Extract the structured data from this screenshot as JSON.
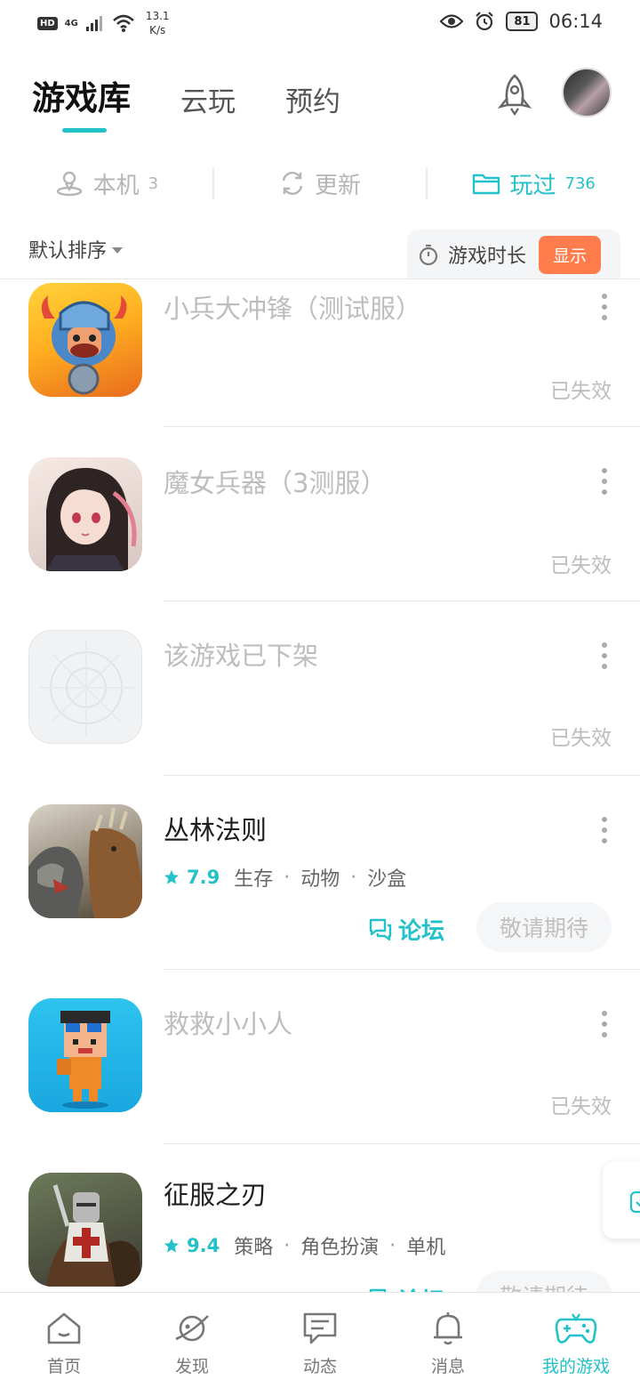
{
  "status_bar": {
    "hd": "HD",
    "network": "4G",
    "speed_value": "13.1",
    "speed_unit": "K/s",
    "battery": "81",
    "time": "06:14"
  },
  "header": {
    "tabs": [
      {
        "label": "游戏库",
        "active": true
      },
      {
        "label": "云玩",
        "active": false
      },
      {
        "label": "预约",
        "active": false
      }
    ]
  },
  "filters": [
    {
      "label": "本机",
      "count": "3",
      "active": false
    },
    {
      "label": "更新",
      "count": "",
      "active": false
    },
    {
      "label": "玩过",
      "count": "736",
      "active": true
    }
  ],
  "sort": {
    "label": "默认排序",
    "duration_label": "游戏时长",
    "show_label": "显示"
  },
  "games": [
    {
      "title": "小兵大冲锋（测试服）",
      "status": "已失效"
    },
    {
      "title": "魔女兵器（3测服）",
      "status": "已失效"
    },
    {
      "title": "该游戏已下架",
      "status": "已失效"
    },
    {
      "title": "丛林法则",
      "score": "7.9",
      "tags": [
        "生存",
        "动物",
        "沙盒"
      ],
      "forum": "论坛",
      "action": "敬请期待"
    },
    {
      "title": "救救小小人",
      "status": "已失效"
    },
    {
      "title": "征服之刃",
      "score": "9.4",
      "tags": [
        "策略",
        "角色扮演",
        "单机"
      ],
      "forum": "论坛",
      "action": "敬请期待"
    }
  ],
  "bottom_nav": [
    {
      "label": "首页",
      "icon": "home-icon"
    },
    {
      "label": "发现",
      "icon": "planet-icon"
    },
    {
      "label": "动态",
      "icon": "message-square-icon"
    },
    {
      "label": "消息",
      "icon": "bell-icon"
    },
    {
      "label": "我的游戏",
      "icon": "gamepad-icon",
      "active": true
    }
  ],
  "colors": {
    "accent": "#23c1c9",
    "show_button": "#ff7d4d",
    "invalid_text": "#bdbdbd"
  }
}
